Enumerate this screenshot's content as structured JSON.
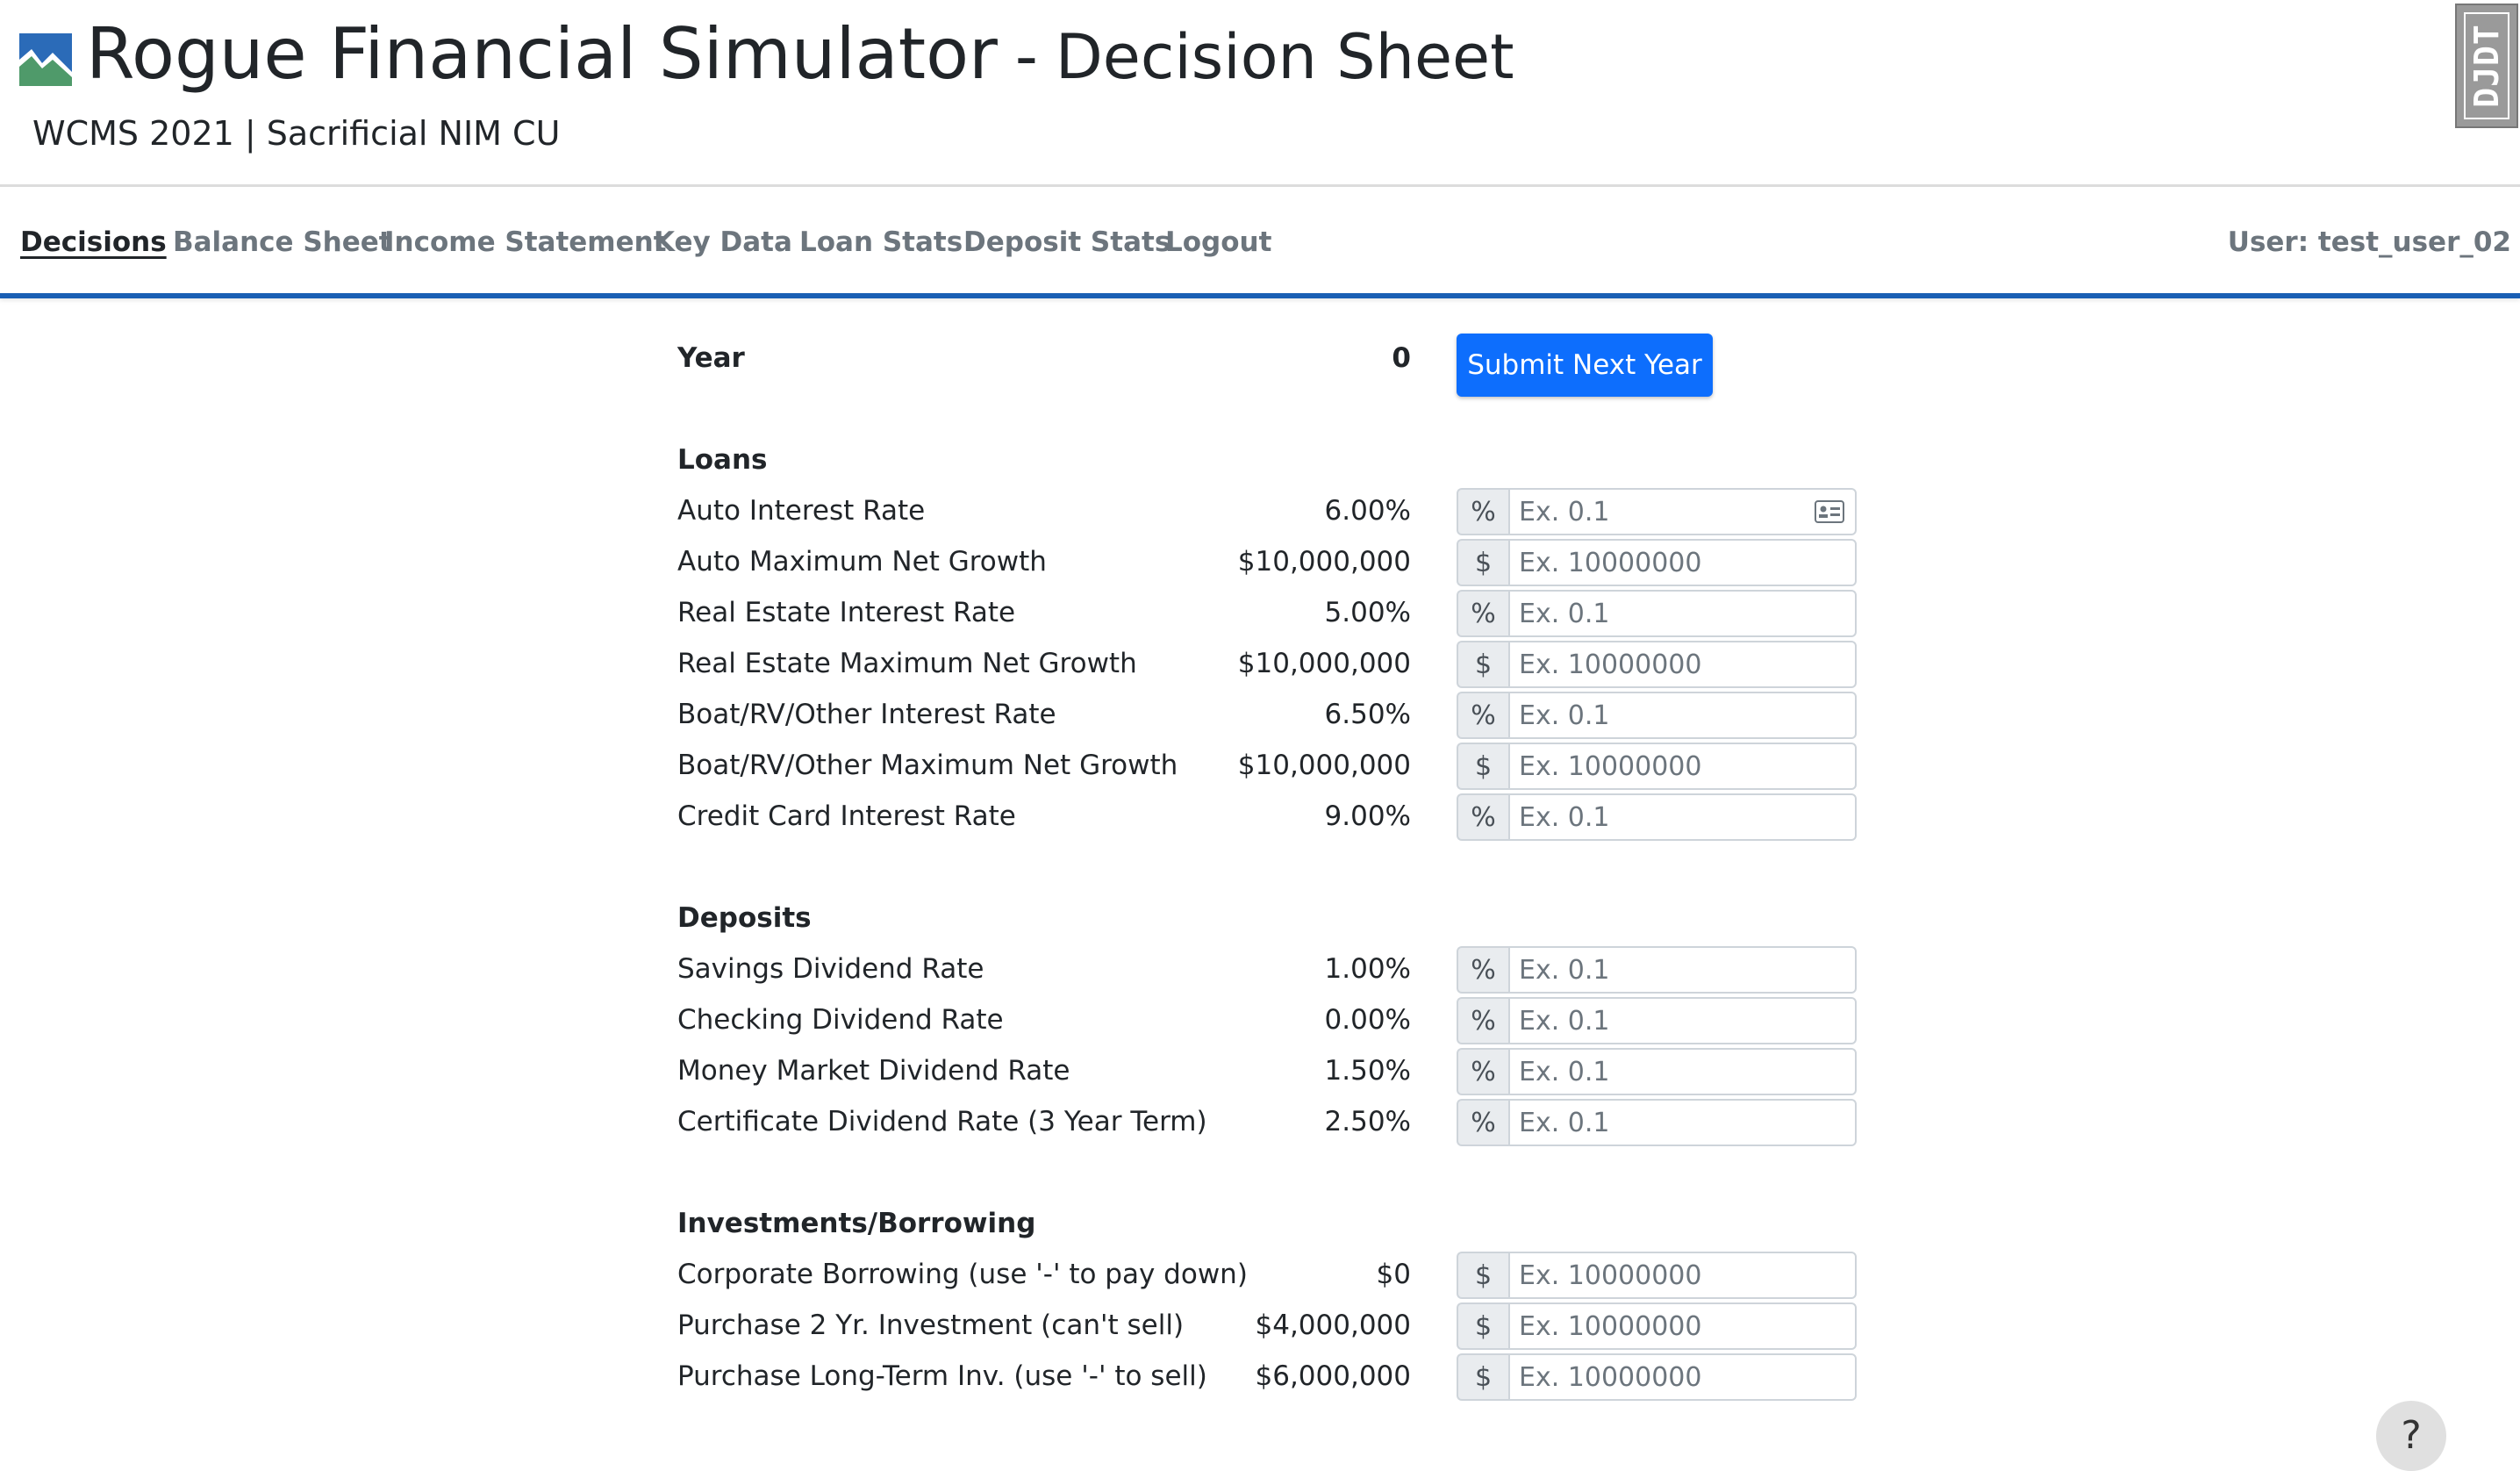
{
  "header": {
    "title": "Rogue Financial Simulator",
    "separator": "-",
    "title_suffix": "Decision Sheet",
    "subtitle": "WCMS 2021 | Sacrificial NIM CU",
    "badge": "DJDT"
  },
  "nav": {
    "items": [
      {
        "label": "Decisions",
        "active": true
      },
      {
        "label": "Balance Sheet"
      },
      {
        "label": "Income Statement"
      },
      {
        "label": "Key Data"
      },
      {
        "label": "Loan Stats"
      },
      {
        "label": "Deposit Stats"
      },
      {
        "label": "Logout"
      }
    ],
    "user": "User: test_user_02"
  },
  "year": {
    "label": "Year",
    "value": "0",
    "submit_label": "Submit Next Year"
  },
  "loans": {
    "heading": "Loans",
    "rows": [
      {
        "label": "Auto Interest Rate",
        "value": "6.00%",
        "unit": "%",
        "placeholder": "Ex. 0.1"
      },
      {
        "label": "Auto Maximum Net Growth",
        "value": "$10,000,000",
        "unit": "$",
        "placeholder": "Ex. 10000000"
      },
      {
        "label": "Real Estate Interest Rate",
        "value": "5.00%",
        "unit": "%",
        "placeholder": "Ex. 0.1"
      },
      {
        "label": "Real Estate Maximum Net Growth",
        "value": "$10,000,000",
        "unit": "$",
        "placeholder": "Ex. 10000000"
      },
      {
        "label": "Boat/RV/Other Interest Rate",
        "value": "6.50%",
        "unit": "%",
        "placeholder": "Ex. 0.1"
      },
      {
        "label": "Boat/RV/Other Maximum Net Growth",
        "value": "$10,000,000",
        "unit": "$",
        "placeholder": "Ex. 10000000"
      },
      {
        "label": "Credit Card Interest Rate",
        "value": "9.00%",
        "unit": "%",
        "placeholder": "Ex. 0.1"
      }
    ]
  },
  "deposits": {
    "heading": "Deposits",
    "rows": [
      {
        "label": "Savings Dividend Rate",
        "value": "1.00%",
        "unit": "%",
        "placeholder": "Ex. 0.1"
      },
      {
        "label": "Checking Dividend Rate",
        "value": "0.00%",
        "unit": "%",
        "placeholder": "Ex. 0.1"
      },
      {
        "label": "Money Market Dividend Rate",
        "value": "1.50%",
        "unit": "%",
        "placeholder": "Ex. 0.1"
      },
      {
        "label": "Certificate Dividend Rate (3 Year Term)",
        "value": "2.50%",
        "unit": "%",
        "placeholder": "Ex. 0.1"
      }
    ]
  },
  "investments": {
    "heading": "Investments/Borrowing",
    "rows": [
      {
        "label": "Corporate Borrowing (use '-' to pay down)",
        "value": "$0",
        "unit": "$",
        "placeholder": "Ex. 10000000"
      },
      {
        "label": "Purchase 2 Yr. Investment (can't sell)",
        "value": "$4,000,000",
        "unit": "$",
        "placeholder": "Ex. 10000000"
      },
      {
        "label": "Purchase Long-Term Inv. (use '-' to sell)",
        "value": "$6,000,000",
        "unit": "$",
        "placeholder": "Ex. 10000000"
      }
    ]
  },
  "help": {
    "label": "?"
  },
  "colors": {
    "accent": "#0d6efd",
    "nav_border": "#1a5fb4",
    "logo_green": "#4f9a6a",
    "logo_blue": "#2b6bb8"
  }
}
